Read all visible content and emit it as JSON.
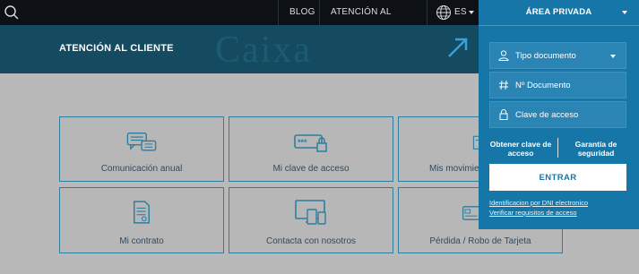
{
  "nav": {
    "blog": "BLOG",
    "atencion": "ATENCIÓN AL CLIENTE",
    "lang": "ES",
    "search_icon": "search-icon",
    "globe_icon": "globe-icon"
  },
  "hero": {
    "title": "ATENCIÓN AL CLIENTE",
    "watermark": "Caixa"
  },
  "cards": [
    {
      "label": "Comunicación anual",
      "icon": "chat-bubbles-icon"
    },
    {
      "label": "Mi clave de acceso",
      "icon": "password-lock-icon"
    },
    {
      "label": "Mis movimie",
      "icon": "document-icon"
    },
    {
      "label": "Mi contrato",
      "icon": "contract-icon"
    },
    {
      "label": "Contacta con nosotros",
      "icon": "devices-icon"
    },
    {
      "label": "Pérdida / Robo de Tarjeta",
      "icon": "card-icon"
    }
  ],
  "panel": {
    "title": "ÁREA PRIVADA",
    "doc_type": "Tipo documento",
    "doc_number": "Nº Documento",
    "password": "Clave de acceso",
    "get_key": "Obtener clave de acceso",
    "guarantee": "Garantía de seguridad",
    "enter": "ENTRAR",
    "dni_link": "Identificacion por DNI electronico",
    "requirements_link": "Verificar requisitos de acceso"
  },
  "colors": {
    "topbar": "#0d1116",
    "hero": "#144b61",
    "panel": "#1776a8",
    "accent": "#2f7ea0"
  }
}
